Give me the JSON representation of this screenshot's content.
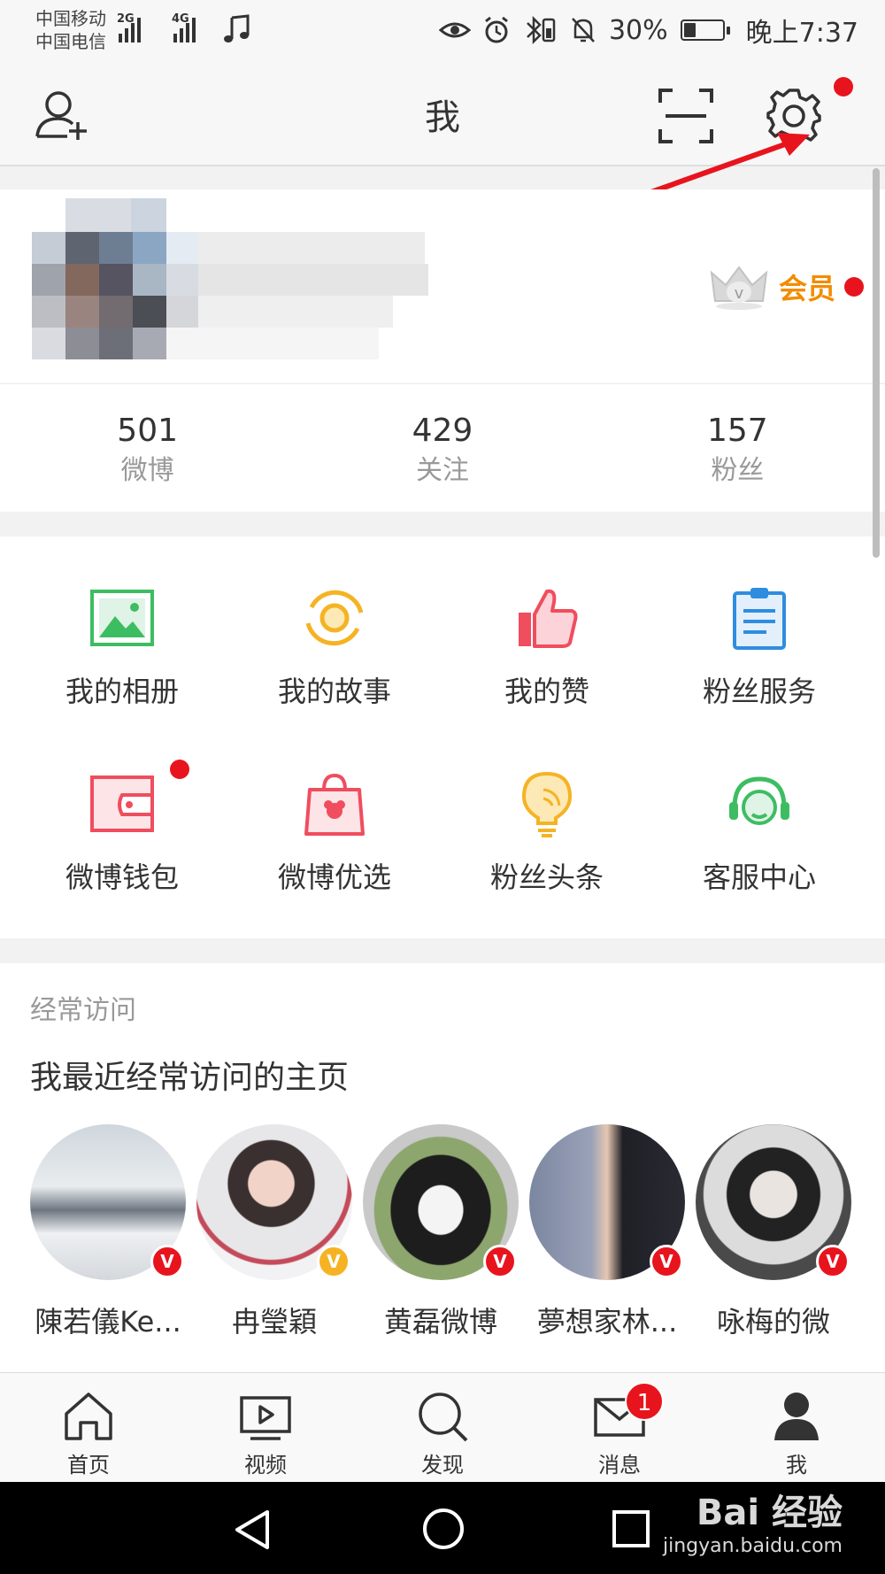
{
  "status_bar": {
    "carrier1": "中国移动",
    "carrier2": "中国电信",
    "net1": "2G",
    "net2": "4G",
    "battery": "30%",
    "battery_level": 0.3,
    "time": "晚上7:37"
  },
  "header": {
    "title": "我"
  },
  "profile": {
    "vip_label": "会员"
  },
  "stats": [
    {
      "value": "501",
      "label": "微博"
    },
    {
      "value": "429",
      "label": "关注"
    },
    {
      "value": "157",
      "label": "粉丝"
    }
  ],
  "grid": [
    {
      "label": "我的相册",
      "icon": "photo-album-icon",
      "color": "#3dbd61"
    },
    {
      "label": "我的故事",
      "icon": "story-icon",
      "color": "#f5b324"
    },
    {
      "label": "我的赞",
      "icon": "thumbs-up-icon",
      "color": "#f04d5e"
    },
    {
      "label": "粉丝服务",
      "icon": "clipboard-icon",
      "color": "#2f8ddf"
    },
    {
      "label": "微博钱包",
      "icon": "wallet-icon",
      "color": "#f04d5e"
    },
    {
      "label": "微博优选",
      "icon": "shopping-bag-icon",
      "color": "#f04d5e"
    },
    {
      "label": "粉丝头条",
      "icon": "lightbulb-icon",
      "color": "#f5b324"
    },
    {
      "label": "客服中心",
      "icon": "headset-icon",
      "color": "#3dbd61"
    }
  ],
  "frequent": {
    "subtitle": "经常访问",
    "heading": "我最近经常访问的主页",
    "accounts": [
      {
        "name": "陳若儀Ke...",
        "badge": "V",
        "badge_color": "#e8141d"
      },
      {
        "name": "冉瑩穎",
        "badge": "V",
        "badge_color": "#f5b324"
      },
      {
        "name": "黄磊微博",
        "badge": "V",
        "badge_color": "#e8141d"
      },
      {
        "name": "夢想家林...",
        "badge": "V",
        "badge_color": "#e8141d"
      },
      {
        "name": "咏梅的微",
        "badge": "V",
        "badge_color": "#e8141d"
      }
    ]
  },
  "tabs": [
    {
      "label": "首页",
      "icon": "home-icon"
    },
    {
      "label": "视频",
      "icon": "video-icon"
    },
    {
      "label": "发现",
      "icon": "search-icon"
    },
    {
      "label": "消息",
      "icon": "mail-icon",
      "count": "1"
    },
    {
      "label": "我",
      "icon": "person-icon"
    }
  ],
  "watermark": {
    "brand": "Bai  经验",
    "url": "jingyan.baidu.com"
  },
  "colors": {
    "accent_red": "#e8141d",
    "vip_orange": "#f28c00"
  }
}
